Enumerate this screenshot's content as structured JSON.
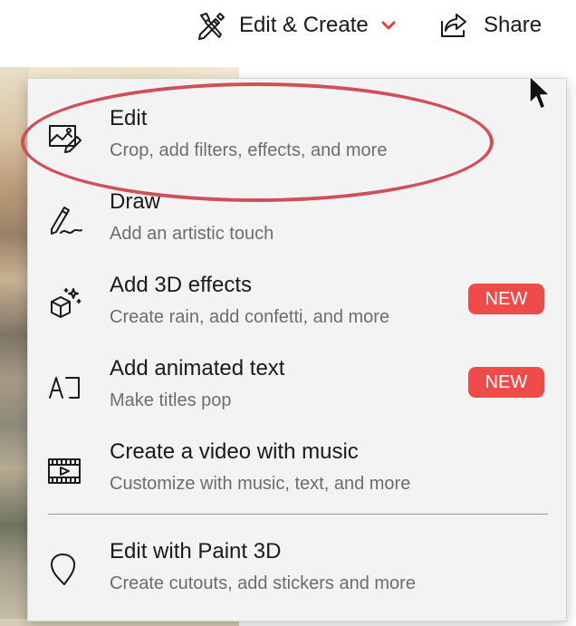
{
  "toolbar": {
    "edit_create": {
      "label": "Edit & Create",
      "icon": "edit-create-icon"
    },
    "share": {
      "label": "Share",
      "icon": "share-icon"
    }
  },
  "menu": {
    "items": [
      {
        "title": "Edit",
        "subtitle": "Crop, add filters, effects, and more",
        "icon": "edit-photo-icon"
      },
      {
        "title": "Draw",
        "subtitle": "Add an artistic touch",
        "icon": "draw-pen-icon"
      },
      {
        "title": "Add 3D effects",
        "subtitle": "Create rain, add confetti, and more",
        "icon": "3d-effects-icon",
        "badge": "NEW"
      },
      {
        "title": "Add animated text",
        "subtitle": "Make titles pop",
        "icon": "animated-text-icon",
        "badge": "NEW"
      },
      {
        "title": "Create a video with music",
        "subtitle": "Customize with music, text, and more",
        "icon": "video-music-icon"
      },
      {
        "title": "Edit with Paint 3D",
        "subtitle": "Create cutouts, add stickers and more",
        "icon": "paint3d-icon"
      }
    ]
  },
  "colors": {
    "accent_red": "#ef4b4b",
    "highlight_ring": "#d0505a",
    "chevron": "#e0403f",
    "menu_bg": "#f3f3f3"
  }
}
